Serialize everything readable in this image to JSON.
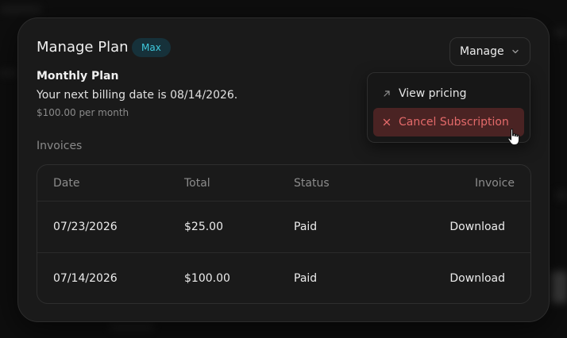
{
  "plan": {
    "title": "Manage Plan",
    "badge": "Max",
    "name": "Monthly Plan",
    "billing_text": "Your next billing date is 08/14/2026.",
    "price": "$100.00 per month"
  },
  "manage_button": {
    "label": "Manage",
    "icon": "chevron-down-icon"
  },
  "menu": {
    "items": [
      {
        "label": "View pricing",
        "icon": "arrow-up-right-icon"
      },
      {
        "label": "Cancel Subscription",
        "icon": "close-icon",
        "highlighted": true
      }
    ]
  },
  "invoices": {
    "heading": "Invoices",
    "columns": [
      "Date",
      "Total",
      "Status",
      "Invoice"
    ],
    "rows": [
      {
        "date": "07/23/2026",
        "total": "$25.00",
        "status": "Paid",
        "action": "Download"
      },
      {
        "date": "07/14/2026",
        "total": "$100.00",
        "status": "Paid",
        "action": "Download"
      }
    ]
  },
  "colors": {
    "badge_text": "#3fc9dd",
    "badge_bg": "#16313a",
    "danger_text": "#e46a6a",
    "danger_bg": "#4a2323"
  }
}
